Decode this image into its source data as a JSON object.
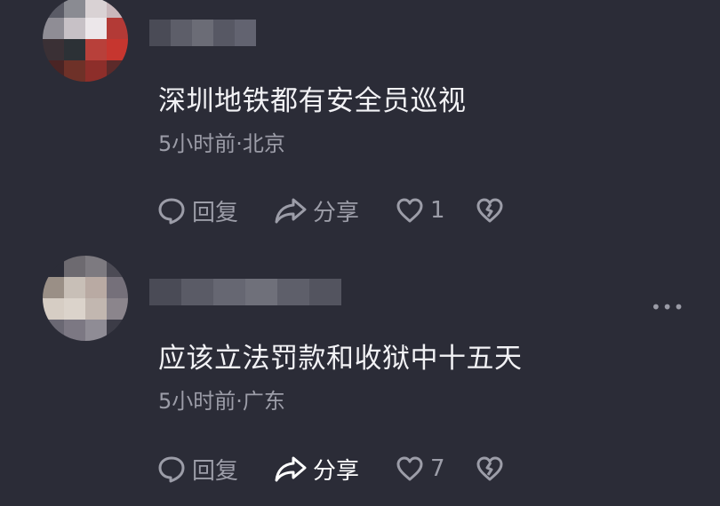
{
  "colors": {
    "background": "#2b2c37",
    "text_primary": "#f2f2f5",
    "text_secondary": "#9c9da8",
    "share_active": "#ffffff"
  },
  "comments": [
    {
      "text": "深圳地铁都有安全员巡视",
      "meta": "5小时前·北京",
      "actions": {
        "reply_label": "回复",
        "share_label": "分享",
        "like_count": "1"
      },
      "avatar_pixels": [
        "#5a5b66",
        "#8a8b92",
        "#d9d2d4",
        "#c9b8bc",
        "#8f8d95",
        "#c7c1c6",
        "#ece7ea",
        "#b33a36",
        "#3a3035",
        "#2c3136",
        "#b8403a",
        "#c6362f",
        "#4a2424",
        "#6e3128",
        "#8d2e2a",
        "#5c2a2a"
      ],
      "username_pixels": [
        "#4a4b56",
        "#5d5e69",
        "#6b6c76",
        "#575864",
        "#626370"
      ]
    },
    {
      "text": "应该立法罚款和收狱中十五天",
      "meta": "5小时前·广东",
      "actions": {
        "reply_label": "回复",
        "share_label": "分享",
        "like_count": "7"
      },
      "avatar_pixels": [
        "#2b2c37",
        "#6d6a70",
        "#7d7a80",
        "#4c4b55",
        "#9a8f86",
        "#c8bfb7",
        "#b9aaa3",
        "#75707a",
        "#d6cdc4",
        "#dbd3cb",
        "#c2b7b0",
        "#8b858c",
        "#6a6873",
        "#7c7883",
        "#8f8c95",
        "#3c3c47"
      ],
      "username_pixels": [
        "#4a4b56",
        "#5a5b66",
        "#666772",
        "#6f707a",
        "#5e5f6a",
        "#53545f"
      ]
    }
  ],
  "icons": {
    "more": "more-dots-icon",
    "reply": "speech-bubble-icon",
    "share": "share-arrow-icon",
    "like": "heart-icon",
    "dislike": "broken-heart-icon"
  }
}
